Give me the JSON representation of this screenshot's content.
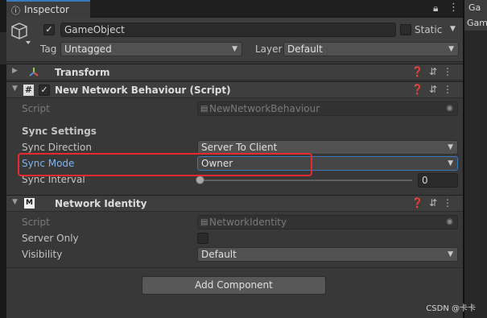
{
  "tabs": {
    "inspector_label": "Inspector",
    "right_tab_label": "Ga",
    "right_sub_label": "Gam"
  },
  "gameobject": {
    "name": "GameObject",
    "static_label": "Static",
    "tag_label": "Tag",
    "tag_value": "Untagged",
    "layer_label": "Layer",
    "layer_value": "Default"
  },
  "components": {
    "transform": {
      "title": "Transform"
    },
    "network_behaviour": {
      "title": "New Network Behaviour (Script)",
      "script_label": "Script",
      "script_value": "NewNetworkBehaviour",
      "sync_settings_label": "Sync Settings",
      "sync_direction_label": "Sync Direction",
      "sync_direction_value": "Server To Client",
      "sync_mode_label": "Sync Mode",
      "sync_mode_value": "Owner",
      "sync_interval_label": "Sync Interval",
      "sync_interval_value": "0"
    },
    "network_identity": {
      "title": "Network Identity",
      "script_label": "Script",
      "script_value": "NetworkIdentity",
      "server_only_label": "Server Only",
      "visibility_label": "Visibility",
      "visibility_value": "Default"
    }
  },
  "add_component_label": "Add Component",
  "watermark": "CSDN @卡卡",
  "colors": {
    "background": "#383838",
    "header": "#3e3e3e",
    "accent_tab": "#3a79bb",
    "highlight_border": "#e8292d",
    "blue_label": "#7eb4f2"
  },
  "icons": [
    "info-icon",
    "lock-icon",
    "menu-icon",
    "gameobject-cube-icon",
    "transform-axes-icon",
    "script-hash-icon",
    "network-identity-icon",
    "help-icon",
    "preset-sliders-icon",
    "kebab-menu-icon",
    "script-file-icon",
    "object-picker-icon"
  ]
}
